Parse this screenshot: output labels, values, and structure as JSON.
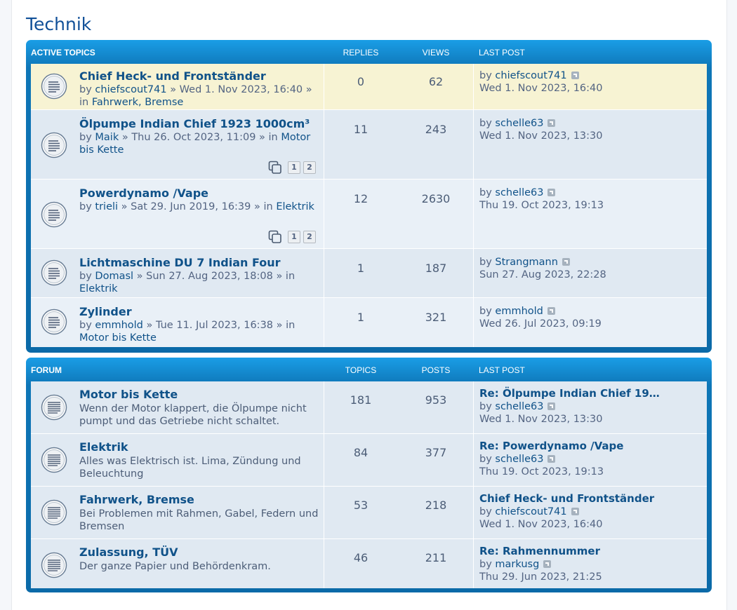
{
  "page": {
    "title": "Technik"
  },
  "active_topics": {
    "header": {
      "title": "ACTIVE TOPICS",
      "col1": "REPLIES",
      "col2": "VIEWS",
      "col3": "LAST POST"
    },
    "rows": [
      {
        "title": "Chief Heck- und Frontständer",
        "by": "by",
        "author": "chiefscout741",
        "date": "» Wed 1. Nov 2023, 16:40",
        "in": "» in",
        "forum": "Fahrwerk, Bremse",
        "replies": "0",
        "views": "62",
        "last_by": "by",
        "last_user": "chiefscout741",
        "last_date": "Wed 1. Nov 2023, 16:40",
        "pages": []
      },
      {
        "title": "Ölpumpe Indian Chief 1923 1000cm³",
        "by": "by",
        "author": "Maik",
        "date": "» Thu 26. Oct 2023, 11:09",
        "in": "» in",
        "forum": "Motor bis Kette",
        "replies": "11",
        "views": "243",
        "last_by": "by",
        "last_user": "schelle63",
        "last_date": "Wed 1. Nov 2023, 13:30",
        "pages": [
          "1",
          "2"
        ]
      },
      {
        "title": "Powerdynamo /Vape",
        "by": "by",
        "author": "trieli",
        "date": "» Sat 29. Jun 2019, 16:39",
        "in": "» in",
        "forum": "Elektrik",
        "replies": "12",
        "views": "2630",
        "last_by": "by",
        "last_user": "schelle63",
        "last_date": "Thu 19. Oct 2023, 19:13",
        "pages": [
          "1",
          "2"
        ]
      },
      {
        "title": "Lichtmaschine DU 7 Indian Four",
        "by": "by",
        "author": "Domasl",
        "date": "» Sun 27. Aug 2023, 18:08",
        "in": "» in",
        "forum": "Elektrik",
        "replies": "1",
        "views": "187",
        "last_by": "by",
        "last_user": "Strangmann",
        "last_date": "Sun 27. Aug 2023, 22:28",
        "pages": []
      },
      {
        "title": "Zylinder",
        "by": "by",
        "author": "emmhold",
        "date": "» Tue 11. Jul 2023, 16:38",
        "in": "» in",
        "forum": "Motor bis Kette",
        "replies": "1",
        "views": "321",
        "last_by": "by",
        "last_user": "emmhold",
        "last_date": "Wed 26. Jul 2023, 09:19",
        "pages": []
      }
    ]
  },
  "forum": {
    "header": {
      "title": "FORUM",
      "col1": "TOPICS",
      "col2": "POSTS",
      "col3": "LAST POST"
    },
    "rows": [
      {
        "title": "Motor bis Kette",
        "desc": "Wenn der Motor klappert, die Ölpumpe nicht pumpt und das Getriebe nicht schaltet.",
        "topics": "181",
        "posts": "953",
        "last_title": "Re: Ölpumpe Indian Chief 19…",
        "last_by": "by",
        "last_user": "schelle63",
        "last_date": "Wed 1. Nov 2023, 13:30"
      },
      {
        "title": "Elektrik",
        "desc": "Alles was Elektrisch ist. Lima, Zündung und Beleuchtung",
        "topics": "84",
        "posts": "377",
        "last_title": "Re: Powerdynamo /Vape",
        "last_by": "by",
        "last_user": "schelle63",
        "last_date": "Thu 19. Oct 2023, 19:13"
      },
      {
        "title": "Fahrwerk, Bremse",
        "desc": "Bei Problemen mit Rahmen, Gabel, Federn und Bremsen",
        "topics": "53",
        "posts": "218",
        "last_title": "Chief Heck- und Frontständer",
        "last_by": "by",
        "last_user": "chiefscout741",
        "last_date": "Wed 1. Nov 2023, 16:40"
      },
      {
        "title": "Zulassung, TÜV",
        "desc": "Der ganze Papier und Behördenkram.",
        "topics": "46",
        "posts": "211",
        "last_title": "Re: Rahmennummer",
        "last_by": "by",
        "last_user": "markusg",
        "last_date": "Thu 29. Jun 2023, 21:25"
      }
    ]
  },
  "icons": {
    "topic": "topic-read-icon",
    "forum": "forum-read-icon",
    "goto": "view-latest-post-icon",
    "multipage": "multipage-icon"
  }
}
